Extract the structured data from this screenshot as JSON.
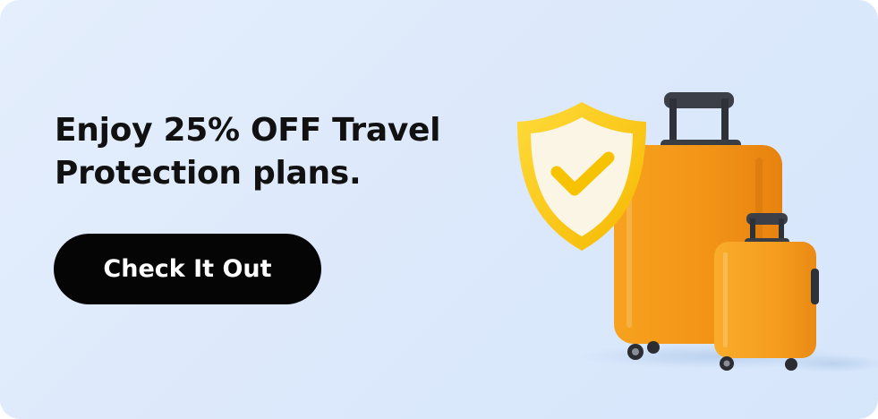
{
  "promo": {
    "headline_line1": "Enjoy 25% OFF Travel",
    "headline_line2": "Protection plans.",
    "cta_label": "Check It Out"
  },
  "illustration": {
    "shield_icon": "shield-check-icon",
    "luggage": [
      "large-suitcase",
      "small-suitcase"
    ]
  },
  "colors": {
    "background": "#dde9fb",
    "button": "#050505",
    "button_text": "#ffffff",
    "suitcase": "#f39a1c",
    "shield": "#ffc61a"
  }
}
